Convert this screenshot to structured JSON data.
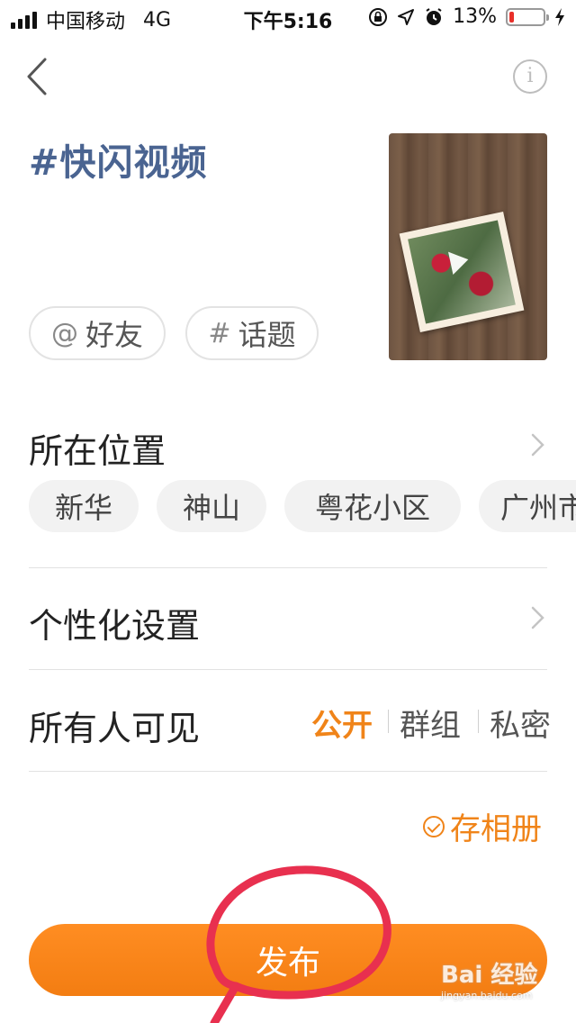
{
  "status_bar": {
    "carrier": "中国移动",
    "network": "4G",
    "time": "下午5:16",
    "battery_percent": "13%",
    "battery_level": 0.13
  },
  "topic": "#快闪视频",
  "tags": {
    "friends": {
      "symbol": "@",
      "label": "好友"
    },
    "topic": {
      "symbol": "#",
      "label": "话题"
    }
  },
  "location": {
    "title": "所在位置",
    "suggestions": [
      "新华",
      "神山",
      "粤花小区",
      "广州市"
    ]
  },
  "personalize": {
    "title": "个性化设置"
  },
  "visibility": {
    "title": "所有人可见",
    "options": [
      "公开",
      "群组",
      "私密"
    ],
    "selected": "公开"
  },
  "save_album": {
    "label": "存相册",
    "checked": true
  },
  "publish_button": {
    "label": "发布"
  },
  "watermark": {
    "logo_text": "Bai 经验",
    "url_text": "jingyan.baidu.com"
  },
  "colors": {
    "accent": "#f08419",
    "topic": "#4a6491",
    "annotation": "#e8304f"
  }
}
